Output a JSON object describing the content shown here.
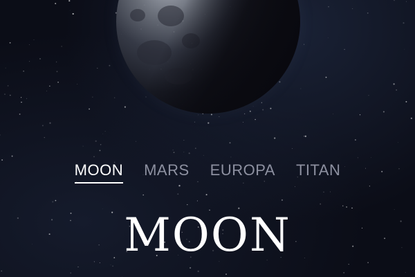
{
  "tabs": [
    {
      "label": "MOON",
      "active": true
    },
    {
      "label": "MARS",
      "active": false
    },
    {
      "label": "EUROPA",
      "active": false
    },
    {
      "label": "TITAN",
      "active": false
    }
  ],
  "destination": {
    "title": "MOON"
  },
  "colors": {
    "background": "#0b0d17",
    "tab_inactive": "#8d90a0",
    "tab_active": "#ffffff"
  },
  "icons": {
    "planet": "moon-image"
  }
}
